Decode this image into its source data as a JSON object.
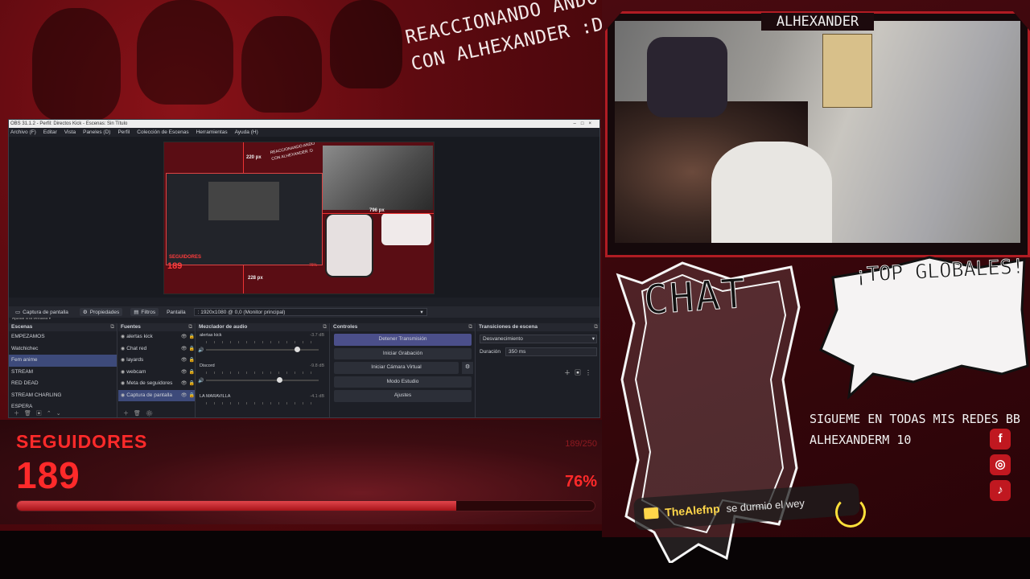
{
  "overlay": {
    "headline_line1": "REACCIONANDO ANDO",
    "headline_line2": "CON ALHEXANDER :D",
    "streamer_name": "ALHEXANDER",
    "chat_label": "CHAT",
    "top_label": "¡TOP GLOBALES!",
    "social_line1": "SIGUEME EN TODAS MIS REDES BB",
    "social_line2": "ALHEXANDERM 10",
    "social_icons": [
      "facebook-icon",
      "instagram-icon",
      "tiktok-icon"
    ],
    "accent_color": "#ff2a2a"
  },
  "chat_message": {
    "user": "TheAlefnp",
    "text": "se durmio el wey"
  },
  "followers": {
    "title": "SEGUIDORES",
    "count": "189",
    "goal": "189/250",
    "percent_text": "76%",
    "progress": 0.76
  },
  "obs": {
    "title": "OBS 31.1.2 - Perfil: Directos Kick - Escenas: Sin Título",
    "menu": [
      "Archivo (F)",
      "Editar",
      "Vista",
      "Paneles (D)",
      "Perfil",
      "Colección de Escenas",
      "Herramientas",
      "Ayuda (H)"
    ],
    "preview": {
      "width_label": "220 px",
      "height_label": "796 px",
      "bottom_label": "228 px",
      "nested_title": "SEGUIDORES",
      "nested_count": "189",
      "nested_pct": "76%"
    },
    "zoom_text": "Ajustar a la ventana",
    "source_toolbar": {
      "source_name": "Captura de pantalla",
      "properties": "Propiedades",
      "filters": "Filtros",
      "display_label": "Pantalla",
      "display_value": ": 1920x1080 @ 0,0 (Monitor principal)"
    },
    "scenes": {
      "header": "Escenas",
      "items": [
        "EMPEZAMOS",
        "Watchichec",
        "Fem anime",
        "STREAM",
        "RED DEAD",
        "STREAM CHARLING",
        "ESPERA"
      ],
      "active_index": 2
    },
    "sources": {
      "header": "Fuentes",
      "items": [
        "alertas kick",
        "Chat red",
        "layards",
        "webcam",
        "Meta de seguidores",
        "Captura de pantalla"
      ],
      "active_index": 5
    },
    "mixer": {
      "header": "Mezclador de audio",
      "channels": [
        {
          "name": "alertas kick",
          "db": "-3.7 dB"
        },
        {
          "name": "Discord",
          "db": "-9.8 dB"
        },
        {
          "name": "LA MARAVILLA",
          "db": "-4.1 dB"
        }
      ]
    },
    "controls": {
      "header": "Controles",
      "stop_stream": "Detener Transmisión",
      "start_recording": "Iniciar Grabación",
      "virtual_cam": "Iniciar Cámara Virtual",
      "studio_mode": "Modo Estudio",
      "settings": "Ajustes"
    },
    "transitions": {
      "header": "Transiciones de escena",
      "type": "Desvanecimiento",
      "duration_label": "Duración",
      "duration_value": "350 ms"
    }
  }
}
